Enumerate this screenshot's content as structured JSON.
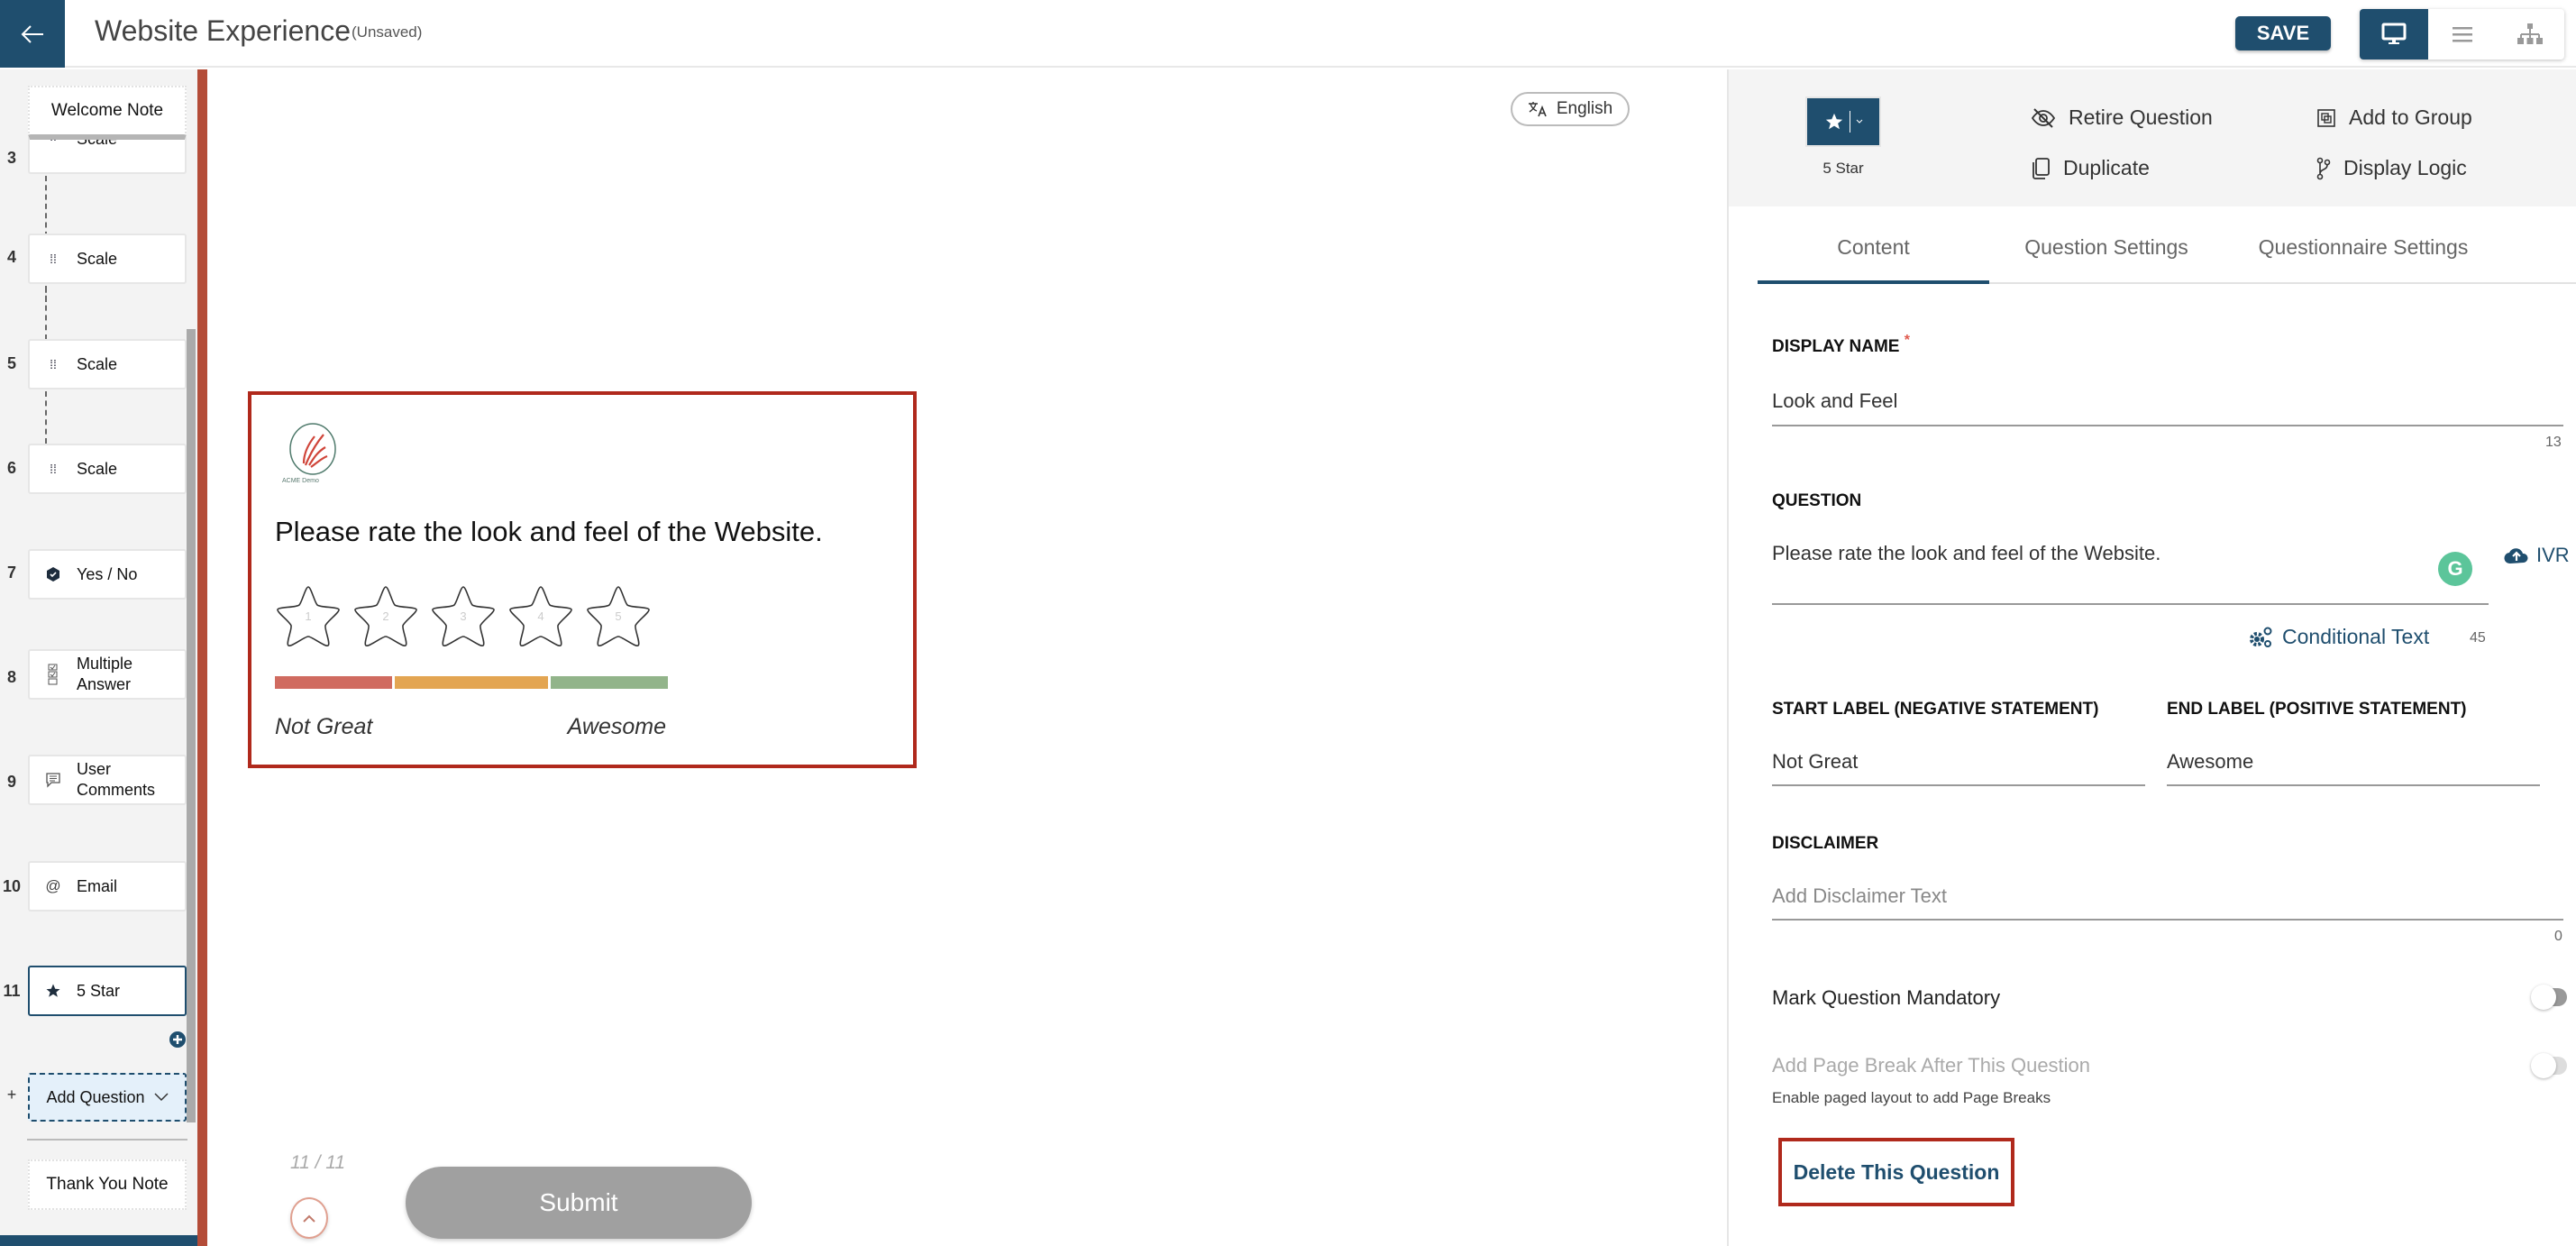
{
  "header": {
    "back_icon": "arrow-left-icon",
    "title": "Website Experience",
    "status": "(Unsaved)",
    "save_label": "SAVE",
    "view_modes": [
      {
        "name": "desktop-view",
        "icon": "monitor-icon",
        "active": true
      },
      {
        "name": "list-view",
        "icon": "list-icon",
        "active": false
      },
      {
        "name": "tree-view",
        "icon": "sitemap-icon",
        "active": false
      }
    ]
  },
  "sidebar": {
    "welcome_note": "Welcome Note",
    "thank_you_note": "Thank You Note",
    "questions": [
      {
        "num": "3",
        "label": "Scale",
        "icon": "scale-icon"
      },
      {
        "num": "4",
        "label": "Scale",
        "icon": "scale-icon"
      },
      {
        "num": "5",
        "label": "Scale",
        "icon": "scale-icon"
      },
      {
        "num": "6",
        "label": "Scale",
        "icon": "scale-icon"
      },
      {
        "num": "7",
        "label": "Yes / No",
        "icon": "check-badge-icon"
      },
      {
        "num": "8",
        "label": "Multiple Answer",
        "icon": "checkbox-list-icon"
      },
      {
        "num": "9",
        "label": "User Comments",
        "icon": "comment-icon"
      },
      {
        "num": "10",
        "label": "Email",
        "icon": "at-icon"
      },
      {
        "num": "11",
        "label": "5 Star",
        "icon": "star-icon",
        "selected": true
      }
    ],
    "add_question": {
      "prefix": "+",
      "label": "Add Question"
    }
  },
  "preview": {
    "language": "English",
    "logo_text": "ACME Demo",
    "question": "Please rate the look and feel of the Website.",
    "star_numbers": [
      "1",
      "2",
      "3",
      "4",
      "5"
    ],
    "rating_value": 0,
    "rating_max": 5,
    "bar_colors": [
      "#d06b60",
      "#e3a552",
      "#92b48a"
    ],
    "start_label": "Not Great",
    "end_label": "Awesome",
    "pager": "11 / 11",
    "submit_label": "Submit"
  },
  "panel": {
    "type_label": "5 Star",
    "actions": {
      "retire": "Retire Question",
      "add_group": "Add to Group",
      "duplicate": "Duplicate",
      "display_logic": "Display Logic"
    },
    "tabs": [
      "Content",
      "Question Settings",
      "Questionnaire Settings"
    ],
    "active_tab": "Content",
    "display_name": {
      "label": "DISPLAY NAME",
      "required": "*",
      "value": "Look and Feel",
      "count": "13"
    },
    "question": {
      "label": "QUESTION",
      "value": "Please rate the look and feel of the Website.",
      "count": "45",
      "ivr": "IVR",
      "conditional": "Conditional Text"
    },
    "start_label": {
      "label": "START LABEL (NEGATIVE STATEMENT)",
      "value": "Not Great"
    },
    "end_label": {
      "label": "END LABEL (POSITIVE STATEMENT)",
      "value": "Awesome"
    },
    "disclaimer": {
      "label": "DISCLAIMER",
      "placeholder": "Add Disclaimer Text",
      "count": "0"
    },
    "mandatory": {
      "label": "Mark Question Mandatory",
      "on": false
    },
    "page_break": {
      "label": "Add Page Break After This Question",
      "hint": "Enable paged layout to add Page Breaks",
      "on": false,
      "disabled": true
    },
    "delete_label": "Delete This Question"
  }
}
